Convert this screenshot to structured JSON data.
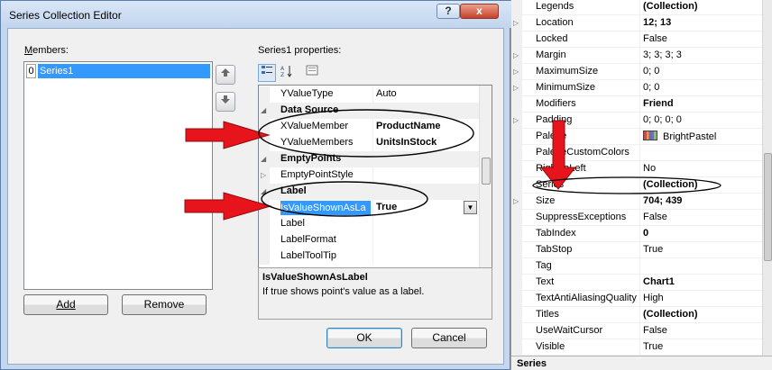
{
  "dialog": {
    "title": "Series Collection Editor",
    "help_label": "?",
    "close_label": "x",
    "members_label": "Members:",
    "members_label_ul": "M",
    "members_rest": "embers:",
    "members": [
      {
        "index": "0",
        "name": "Series1"
      }
    ],
    "move_up_icon": "arrow-up-icon",
    "move_down_icon": "arrow-down-icon",
    "properties_label": "Series1 properties:",
    "toolbar_icons": [
      "categorized-icon",
      "alphabetical-icon",
      "property-pages-icon"
    ],
    "add_label": "Add",
    "remove_label": "Remove",
    "ok_label": "OK",
    "cancel_label": "Cancel",
    "grid_rows": [
      {
        "name": "YValueType",
        "value": "Auto"
      },
      {
        "name": "Data Source",
        "category": true
      },
      {
        "name": "XValueMember",
        "value": "ProductName",
        "bold": true
      },
      {
        "name": "YValueMembers",
        "value": "UnitsInStock",
        "bold": true
      },
      {
        "name": "EmptyPoints",
        "category": true
      },
      {
        "name": "EmptyPointStyle",
        "value": ""
      },
      {
        "name": "Label",
        "category": true
      },
      {
        "name": "IsValueShownAsLa",
        "value": "True",
        "bold": true,
        "selected": true
      },
      {
        "name": "Label",
        "value": ""
      },
      {
        "name": "LabelFormat",
        "value": ""
      },
      {
        "name": "LabelToolTip",
        "value": ""
      }
    ],
    "description_title": "IsValueShownAsLabel",
    "description_text": "If true shows point's value as a label."
  },
  "properties_panel": {
    "rows": [
      {
        "name": "Legends",
        "value": "(Collection)",
        "bold": true
      },
      {
        "name": "Location",
        "value": "12; 13",
        "bold": true,
        "expand": true
      },
      {
        "name": "Locked",
        "value": "False"
      },
      {
        "name": "Margin",
        "value": "3; 3; 3; 3",
        "expand": true
      },
      {
        "name": "MaximumSize",
        "value": "0; 0",
        "expand": true
      },
      {
        "name": "MinimumSize",
        "value": "0; 0",
        "expand": true
      },
      {
        "name": "Modifiers",
        "value": "Friend",
        "bold": true
      },
      {
        "name": "Padding",
        "value": "0; 0; 0; 0",
        "expand": true
      },
      {
        "name": "Palette",
        "value": "BrightPastel",
        "swatch": true
      },
      {
        "name": "PaletteCustomColors",
        "value": ""
      },
      {
        "name": "RightToLeft",
        "value": "No"
      },
      {
        "name": "Series",
        "value": "(Collection)",
        "bold": true
      },
      {
        "name": "Size",
        "value": "704; 439",
        "bold": true,
        "expand": true
      },
      {
        "name": "SuppressExceptions",
        "value": "False"
      },
      {
        "name": "TabIndex",
        "value": "0",
        "bold": true
      },
      {
        "name": "TabStop",
        "value": "True"
      },
      {
        "name": "Tag",
        "value": ""
      },
      {
        "name": "Text",
        "value": "Chart1",
        "bold": true
      },
      {
        "name": "TextAntiAliasingQuality",
        "value": "High"
      },
      {
        "name": "Titles",
        "value": "(Collection)",
        "bold": true
      },
      {
        "name": "UseWaitCursor",
        "value": "False"
      },
      {
        "name": "Visible",
        "value": "True"
      }
    ],
    "footer": "Series"
  },
  "annotations": {
    "arrow_color": "#e8141b",
    "ellipse_color": "#000000"
  }
}
